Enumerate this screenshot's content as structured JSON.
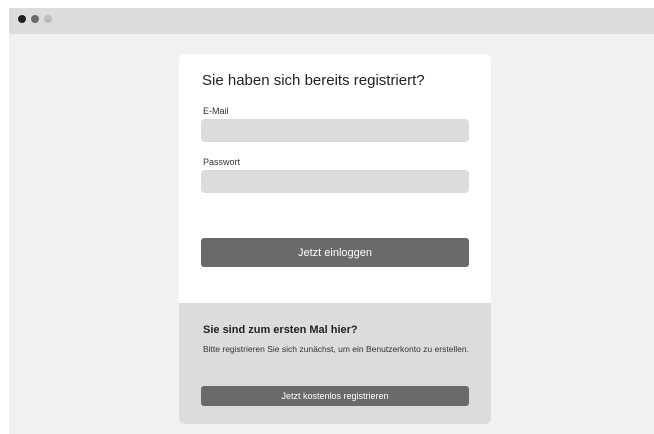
{
  "window": {
    "controls": [
      "close",
      "minimize",
      "maximize"
    ]
  },
  "login": {
    "title": "Sie haben sich bereits registriert?",
    "email_label": "E-Mail",
    "email_value": "",
    "password_label": "Passwort",
    "password_value": "",
    "submit_label": "Jetzt einloggen"
  },
  "register": {
    "title": "Sie sind zum ersten Mal hier?",
    "text": "Bitte registrieren Sie sich zunächst, um ein Benutzerkonto zu erstellen.",
    "button_label": "Jetzt kostenlos registrieren"
  },
  "colors": {
    "page_background": "#f1f1f1",
    "titlebar": "#dcdcdc",
    "card": "#ffffff",
    "input_fill": "#dcdcdc",
    "button": "#6a6a6a",
    "register_panel": "#dcdcdc"
  }
}
